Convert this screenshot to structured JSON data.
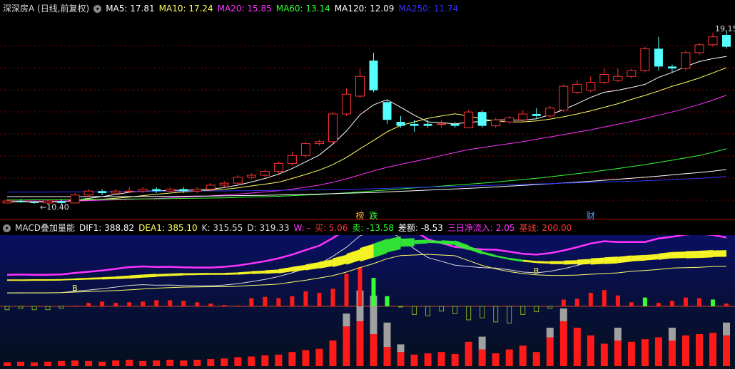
{
  "main": {
    "title": "深深房A (日线,前复权)",
    "ma": [
      {
        "label": "MA5: 17.81",
        "color": "#ffffff"
      },
      {
        "label": "MA10: 17.24",
        "color": "#ffff66"
      },
      {
        "label": "MA20: 15.85",
        "color": "#ff33ff"
      },
      {
        "label": "MA60: 13.14",
        "color": "#33ff33"
      },
      {
        "label": "MA120: 12.09",
        "color": "#ffffff"
      },
      {
        "label": "MA250: 11.74",
        "color": "#3333ff"
      }
    ],
    "high_label": "19.15",
    "low_label": "←10.40",
    "events": [
      {
        "label": "榜",
        "color": "#ffaa33",
        "index": 26
      },
      {
        "label": "跌",
        "color": "#33ff33",
        "index": 27
      },
      {
        "label": "财",
        "color": "#6699ff",
        "index": 43
      }
    ]
  },
  "sub": {
    "title": "MACD叠加量能",
    "items": [
      {
        "label": "DIF1: 388.82",
        "color": "#ffffff"
      },
      {
        "label": "DEA1: 385.10",
        "color": "#ffff66"
      },
      {
        "label": "K: 315.55",
        "color": "#dddddd"
      },
      {
        "label": "D: 319.33",
        "color": "#dddddd"
      },
      {
        "label": "W: -",
        "color": "#ff33ff"
      },
      {
        "label": "买: 5.06",
        "color": "#ff3333"
      },
      {
        "label": "卖: -13.58",
        "color": "#33ff33"
      },
      {
        "label": "差额: -8.53",
        "color": "#ffffff"
      },
      {
        "label": "三日净流入: 2.05",
        "color": "#ff33ff"
      },
      {
        "label": "基线: 200.00",
        "color": "#ff3333"
      }
    ],
    "b_markers": [
      {
        "label": "B",
        "index": 5
      },
      {
        "label": "B",
        "index": 39
      }
    ]
  },
  "chart_data": {
    "type": "candlestick",
    "ylim": [
      10.0,
      19.8
    ],
    "candles": [
      [
        10.4,
        10.5,
        10.6,
        10.4
      ],
      [
        10.5,
        10.45,
        10.6,
        10.4
      ],
      [
        10.45,
        10.4,
        10.5,
        10.35
      ],
      [
        10.4,
        10.5,
        10.55,
        10.3
      ],
      [
        10.5,
        10.4,
        10.6,
        10.3
      ],
      [
        10.4,
        10.8,
        10.9,
        10.4
      ],
      [
        10.8,
        11.0,
        11.1,
        10.7
      ],
      [
        11.0,
        10.9,
        11.1,
        10.8
      ],
      [
        10.9,
        11.0,
        11.1,
        10.8
      ],
      [
        11.0,
        11.0,
        11.2,
        10.9
      ],
      [
        11.0,
        11.1,
        11.2,
        10.9
      ],
      [
        11.1,
        11.0,
        11.2,
        10.9
      ],
      [
        11.0,
        11.1,
        11.2,
        11.0
      ],
      [
        11.1,
        11.0,
        11.2,
        10.9
      ],
      [
        11.0,
        11.1,
        11.2,
        10.9
      ],
      [
        11.1,
        11.3,
        11.4,
        11.0
      ],
      [
        11.3,
        11.4,
        11.5,
        11.2
      ],
      [
        11.4,
        11.7,
        11.8,
        11.3
      ],
      [
        11.7,
        11.8,
        11.9,
        11.6
      ],
      [
        11.8,
        12.0,
        12.1,
        11.7
      ],
      [
        12.0,
        12.4,
        12.5,
        11.9
      ],
      [
        12.4,
        12.8,
        13.0,
        12.3
      ],
      [
        12.8,
        13.4,
        13.5,
        12.7
      ],
      [
        13.4,
        13.5,
        13.6,
        13.3
      ],
      [
        13.5,
        14.9,
        15.0,
        13.4
      ],
      [
        14.9,
        15.9,
        16.2,
        14.8
      ],
      [
        15.8,
        16.8,
        17.2,
        15.7
      ],
      [
        17.6,
        16.1,
        18.0,
        16.0
      ],
      [
        15.5,
        14.6,
        15.6,
        14.4
      ],
      [
        14.5,
        14.3,
        14.8,
        14.2
      ],
      [
        14.4,
        14.3,
        14.6,
        14.0
      ],
      [
        14.4,
        14.3,
        14.6,
        14.2
      ],
      [
        14.4,
        14.4,
        14.6,
        14.2
      ],
      [
        14.4,
        14.3,
        14.5,
        14.2
      ],
      [
        14.2,
        15.0,
        15.1,
        14.2
      ],
      [
        15.0,
        14.3,
        15.1,
        14.2
      ],
      [
        14.3,
        14.6,
        14.7,
        14.2
      ],
      [
        14.5,
        14.7,
        14.8,
        14.4
      ],
      [
        14.6,
        14.9,
        15.1,
        14.6
      ],
      [
        14.9,
        14.8,
        15.2,
        14.7
      ],
      [
        14.8,
        15.2,
        15.3,
        14.7
      ],
      [
        15.1,
        16.3,
        16.4,
        15.0
      ],
      [
        16.0,
        16.4,
        16.6,
        15.9
      ],
      [
        16.1,
        16.5,
        16.8,
        16.0
      ],
      [
        16.5,
        16.9,
        17.2,
        16.4
      ],
      [
        16.6,
        16.8,
        17.2,
        16.5
      ],
      [
        16.8,
        17.1,
        17.2,
        16.7
      ],
      [
        17.1,
        18.2,
        18.3,
        17.0
      ],
      [
        18.2,
        17.3,
        18.8,
        17.1
      ],
      [
        17.3,
        17.2,
        17.4,
        17.0
      ],
      [
        17.2,
        18.0,
        18.1,
        17.1
      ],
      [
        18.0,
        18.4,
        18.5,
        17.9
      ],
      [
        18.4,
        18.8,
        19.0,
        18.3
      ],
      [
        18.9,
        18.3,
        19.15,
        18.2
      ]
    ],
    "series": [
      {
        "name": "MA5",
        "color": "#ffffff",
        "values": [
          10.45,
          10.46,
          10.45,
          10.45,
          10.47,
          10.55,
          10.63,
          10.72,
          10.83,
          10.94,
          11.0,
          11.0,
          11.04,
          11.04,
          11.06,
          11.1,
          11.18,
          11.3,
          11.46,
          11.64,
          11.86,
          12.14,
          12.48,
          12.82,
          13.38,
          14.04,
          14.86,
          15.36,
          15.62,
          15.24,
          14.84,
          14.5,
          14.46,
          14.4,
          14.48,
          14.52,
          14.6,
          14.6,
          14.58,
          14.66,
          14.86,
          15.12,
          15.42,
          15.74,
          16.0,
          16.1,
          16.24,
          16.4,
          16.75,
          17.0,
          17.3,
          17.55,
          17.7,
          17.81
        ]
      },
      {
        "name": "MA10",
        "color": "#ffff66",
        "values": [
          10.45,
          10.45,
          10.46,
          10.46,
          10.47,
          10.5,
          10.55,
          10.59,
          10.64,
          10.7,
          10.77,
          10.84,
          10.9,
          10.96,
          11.0,
          11.05,
          11.09,
          11.16,
          11.26,
          11.35,
          11.45,
          11.64,
          11.84,
          12.06,
          12.34,
          12.7,
          13.14,
          13.56,
          14.0,
          14.32,
          14.5,
          14.68,
          14.8,
          14.91,
          14.8,
          14.64,
          14.55,
          14.5,
          14.5,
          14.55,
          14.64,
          14.76,
          14.9,
          15.06,
          15.24,
          15.42,
          15.64,
          15.84,
          16.06,
          16.3,
          16.5,
          16.72,
          16.98,
          17.24
        ]
      },
      {
        "name": "MA20",
        "color": "#ff33ff",
        "values": [
          10.5,
          10.5,
          10.5,
          10.5,
          10.5,
          10.5,
          10.52,
          10.54,
          10.56,
          10.58,
          10.6,
          10.63,
          10.66,
          10.69,
          10.72,
          10.76,
          10.8,
          10.85,
          10.9,
          10.96,
          11.02,
          11.1,
          11.2,
          11.3,
          11.45,
          11.62,
          11.82,
          12.02,
          12.2,
          12.35,
          12.5,
          12.64,
          12.8,
          12.95,
          13.1,
          13.2,
          13.3,
          13.4,
          13.5,
          13.62,
          13.74,
          13.86,
          13.98,
          14.1,
          14.24,
          14.38,
          14.52,
          14.68,
          14.84,
          15.0,
          15.18,
          15.38,
          15.6,
          15.85
        ]
      },
      {
        "name": "MA60",
        "color": "#33ff33",
        "values": [
          10.55,
          10.55,
          10.56,
          10.56,
          10.57,
          10.57,
          10.58,
          10.58,
          10.59,
          10.6,
          10.6,
          10.61,
          10.62,
          10.63,
          10.64,
          10.65,
          10.66,
          10.68,
          10.7,
          10.72,
          10.74,
          10.77,
          10.8,
          10.83,
          10.87,
          10.91,
          10.96,
          11.01,
          11.06,
          11.11,
          11.16,
          11.2,
          11.25,
          11.3,
          11.35,
          11.4,
          11.46,
          11.52,
          11.58,
          11.65,
          11.72,
          11.8,
          11.88,
          11.96,
          12.05,
          12.14,
          12.24,
          12.34,
          12.45,
          12.56,
          12.68,
          12.8,
          12.96,
          13.14
        ]
      },
      {
        "name": "MA120",
        "color": "#ffffff",
        "values": [
          10.72,
          10.72,
          10.72,
          10.72,
          10.72,
          10.72,
          10.72,
          10.72,
          10.72,
          10.72,
          10.73,
          10.73,
          10.74,
          10.74,
          10.75,
          10.75,
          10.76,
          10.77,
          10.78,
          10.79,
          10.8,
          10.82,
          10.83,
          10.85,
          10.87,
          10.89,
          10.91,
          10.93,
          10.96,
          10.99,
          11.02,
          11.05,
          11.08,
          11.11,
          11.14,
          11.17,
          11.21,
          11.25,
          11.29,
          11.33,
          11.37,
          11.41,
          11.45,
          11.5,
          11.55,
          11.6,
          11.65,
          11.7,
          11.76,
          11.82,
          11.88,
          11.94,
          12.01,
          12.09
        ]
      },
      {
        "name": "MA250",
        "color": "#3333ff",
        "values": [
          10.95,
          10.95,
          10.95,
          10.95,
          10.96,
          10.96,
          10.96,
          10.97,
          10.97,
          10.98,
          10.98,
          10.99,
          10.99,
          11.0,
          11.0,
          11.01,
          11.01,
          11.02,
          11.02,
          11.03,
          11.04,
          11.05,
          11.06,
          11.07,
          11.08,
          11.09,
          11.1,
          11.12,
          11.14,
          11.16,
          11.18,
          11.2,
          11.22,
          11.24,
          11.26,
          11.28,
          11.3,
          11.32,
          11.34,
          11.36,
          11.38,
          11.4,
          11.42,
          11.44,
          11.46,
          11.48,
          11.5,
          11.52,
          11.55,
          11.58,
          11.61,
          11.64,
          11.69,
          11.74
        ]
      }
    ],
    "volume": {
      "red": [
        6,
        7,
        6,
        7,
        8,
        9,
        8,
        7,
        9,
        10,
        8,
        9,
        10,
        9,
        10,
        11,
        12,
        14,
        15,
        17,
        18,
        22,
        25,
        27,
        40,
        62,
        70,
        50,
        30,
        22,
        18,
        20,
        22,
        19,
        38,
        26,
        20,
        26,
        32,
        22,
        45,
        70,
        60,
        48,
        35,
        40,
        38,
        42,
        45,
        40,
        48,
        50,
        52,
        48
      ],
      "gray": [
        0,
        0,
        0,
        0,
        0,
        0,
        0,
        0,
        0,
        0,
        0,
        0,
        0,
        0,
        0,
        0,
        0,
        0,
        0,
        0,
        0,
        0,
        0,
        0,
        0,
        20,
        48,
        60,
        38,
        12,
        0,
        0,
        0,
        0,
        0,
        20,
        0,
        0,
        0,
        0,
        15,
        20,
        0,
        0,
        0,
        20,
        0,
        0,
        0,
        20,
        0,
        0,
        0,
        20
      ]
    },
    "macd_hist": [
      -0.5,
      -0.3,
      -0.5,
      -0.5,
      -0.3,
      0.1,
      0.5,
      0.7,
      0.5,
      0.6,
      0.7,
      0.9,
      0.9,
      0.8,
      0.6,
      0.4,
      0.2,
      0.1,
      1.2,
      1.4,
      1.2,
      1.5,
      2.2,
      2.0,
      2.6,
      4.8,
      5.8,
      4.2,
      1.5,
      -0.1,
      -1.2,
      -1.4,
      -0.7,
      -1.1,
      -2.0,
      -1.7,
      -2.3,
      -2.5,
      -1.2,
      -0.8,
      -0.3,
      1.0,
      1.1,
      2.0,
      2.4,
      1.6,
      0.6,
      1.3,
      0.5,
      0.8,
      1.3,
      1.2,
      1.0,
      0.4
    ]
  }
}
